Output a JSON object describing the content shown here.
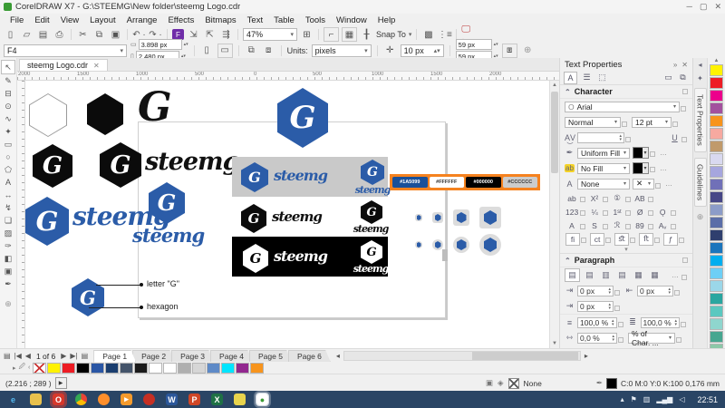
{
  "colors": {
    "brand_blue": "#2B5CA8",
    "banner_gray": "#C9C9C9",
    "orange": "#F5821F",
    "taskbar": "#2A4565"
  },
  "titlebar": {
    "title": "CorelDRAW X7 - G:\\STEEMG\\New folder\\steemg Logo.cdr"
  },
  "menubar": {
    "items": [
      "File",
      "Edit",
      "View",
      "Layout",
      "Arrange",
      "Effects",
      "Bitmaps",
      "Text",
      "Table",
      "Tools",
      "Window",
      "Help"
    ]
  },
  "toolbar": {
    "zoom": "47%",
    "snap_label": "Snap To"
  },
  "propbar": {
    "preset": "F4",
    "page_w": "3.898 px",
    "page_h": "2.480 px",
    "units_label": "Units:",
    "units": "pixels",
    "nudge": "10 px",
    "dup_h": "59 px",
    "dup_v": "59 px"
  },
  "doc_tab": {
    "label": "steemg Logo.cdr",
    "close": "✕"
  },
  "ruler": {
    "labels": [
      "2000",
      "1500",
      "1000",
      "500",
      "0",
      "500",
      "1000",
      "1500",
      "2000"
    ]
  },
  "canvas": {
    "logo_letter": "G",
    "logo_text": "steemg",
    "chips": [
      {
        "label": "#1A5099",
        "bg": "#1A5099",
        "fg": "#FFFFFF"
      },
      {
        "label": "#FFFFFF",
        "bg": "#FFFFFF",
        "fg": "#333333"
      },
      {
        "label": "#000000",
        "bg": "#000000",
        "fg": "#FFFFFF"
      },
      {
        "label": "#CCCCCC",
        "bg": "#CCCCCC",
        "fg": "#333333"
      }
    ],
    "callout_letter": "letter \"G\"",
    "callout_hexagon": "hexagon"
  },
  "docker": {
    "title": "Text Properties",
    "character_title": "Character",
    "font_name": "Arial",
    "font_style": "Normal",
    "font_size": "12 pt",
    "fill_label": "Uniform Fill",
    "bg_fill_label": "No Fill",
    "outline_label": "None",
    "features_r1": [
      "ab",
      "X²",
      "①",
      "AB"
    ],
    "features_r2": [
      "123",
      "¼",
      "1ˢᵗ",
      "Ø",
      "Ǫ"
    ],
    "features_r3": [
      "A",
      "S",
      "ℛ",
      "89",
      "Aᵥ"
    ],
    "features_r4": [
      "ﬁ",
      "ct",
      "ﬆ",
      "ﬅ",
      "ƒ"
    ],
    "paragraph_title": "Paragraph",
    "indent_first": "0 px",
    "indent_right": "0 px",
    "indent_left": "0 px",
    "space_before": "100,0 %",
    "space_after": "100,0 %",
    "char_space": "0,0 %",
    "char_space_unit": "% of Char. ..."
  },
  "tabstrip": {
    "tabs": [
      "Text Properties",
      "Guidelines"
    ]
  },
  "workspace_palette": [
    "#FFF200",
    "#ED1C24",
    "#EC008C",
    "#A3519E",
    "#F7941D",
    "#F7A9A0",
    "#C09A6B",
    "#D9D9F0",
    "#A6A6DE",
    "#7070B8",
    "#474787",
    "#8C9CC8",
    "#5B6EA8",
    "#2F3F6E",
    "#1B75BC",
    "#00AEEF",
    "#6DCFF6",
    "#9BD7E9",
    "#2AA6A0",
    "#5BC8C0",
    "#8FD6CE",
    "#47A690",
    "#8CC8A8",
    "#C8E6D0"
  ],
  "pages": {
    "nav": "1 of 6",
    "tabs": [
      {
        "label": "Page 1",
        "cls": "active"
      },
      {
        "label": "Page 2"
      },
      {
        "label": "Page 3"
      },
      {
        "label": "Page 4"
      },
      {
        "label": "Page 5"
      },
      {
        "label": "Page 6"
      }
    ]
  },
  "doc_palette": [
    {
      "cls": "no-color"
    },
    "#FFF200",
    "#ED1C24",
    "#000000",
    "#2A56A5",
    "#1B3E6F",
    "#44546A",
    "#1A1A1A",
    "#FFFFFF",
    "#FFFFFF",
    "#AFAFAF",
    "#D6D6D6",
    "#5E8AC7",
    "#00E5FF",
    "#92278F",
    "#F7941D"
  ],
  "status": {
    "coords": "(2.216 ; 289  )",
    "fill_none": "None",
    "outline_info": "C:0 M:0 Y:0 K:100  0,176 mm"
  },
  "taskbar": {
    "apps": [
      {
        "name": "internet-explorer",
        "glyph": "e",
        "fg": "#54B9F0"
      },
      {
        "name": "file-explorer",
        "glyph": "",
        "bg": "#E8C14D"
      },
      {
        "name": "opera",
        "glyph": "O",
        "bg": "#D6382C",
        "cls": "highlight"
      },
      {
        "name": "chrome",
        "glyph": "",
        "cls": "chrome"
      },
      {
        "name": "firefox",
        "glyph": "",
        "bg": "#FF8F2B",
        "cls": "round"
      },
      {
        "name": "media-player",
        "glyph": "▸",
        "bg": "#F49A2C"
      },
      {
        "name": "red-app",
        "glyph": "",
        "bg": "#C62F23",
        "cls": "round"
      },
      {
        "name": "word",
        "glyph": "W",
        "bg": "#2B579A"
      },
      {
        "name": "powerpoint",
        "glyph": "P",
        "bg": "#D04727"
      },
      {
        "name": "excel",
        "glyph": "X",
        "bg": "#1E7145"
      },
      {
        "name": "sticky-notes",
        "glyph": "",
        "bg": "#E8D44D"
      },
      {
        "name": "coreldraw",
        "glyph": "●",
        "bg": "#FFFFFF",
        "fg": "#3A9B35",
        "cls": "active-app"
      }
    ],
    "tray": [
      {
        "glyph": "▴"
      },
      {
        "glyph": "⚑"
      },
      {
        "glyph": "▥"
      },
      {
        "glyph": "▂▄▆"
      },
      {
        "glyph": "◁"
      }
    ],
    "clock": "22:51"
  }
}
